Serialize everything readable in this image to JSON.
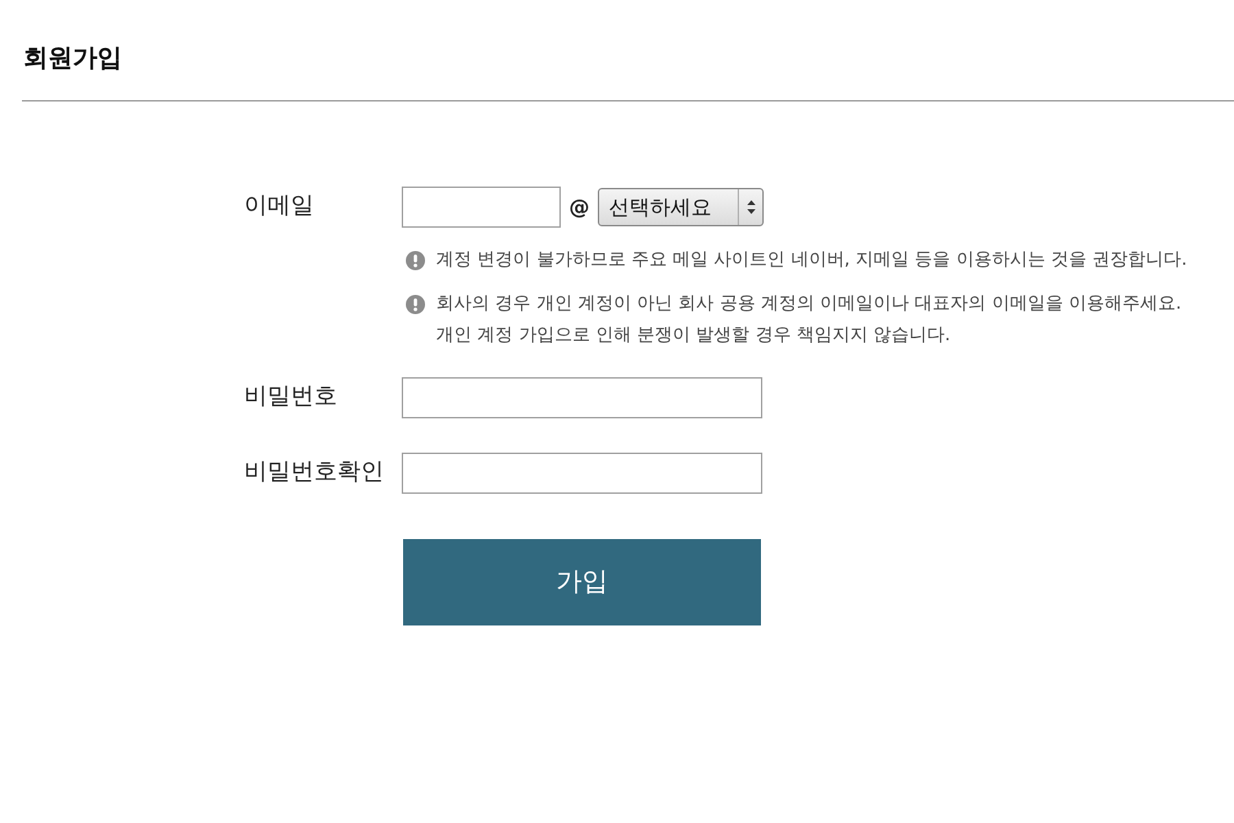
{
  "page": {
    "title": "회원가입"
  },
  "form": {
    "fields": [
      {
        "kind": "email",
        "label": "이메일",
        "at_sign": "@",
        "domain_select": {
          "value": "선택하세요"
        },
        "notes": [
          {
            "lines": [
              "계정 변경이 불가하므로 주요 메일 사이트인 네이버, 지메일 등을 이용하시는 것을 권장합니다."
            ]
          },
          {
            "lines": [
              "회사의 경우 개인 계정이 아닌 회사 공용 계정의 이메일이나 대표자의 이메일을 이용해주세요.",
              "개인 계정 가입으로 인해 분쟁이 발생할 경우 책임지지 않습니다."
            ]
          }
        ]
      },
      {
        "kind": "password",
        "label": "비밀번호"
      },
      {
        "kind": "password",
        "label": "비밀번호확인"
      }
    ],
    "submit": {
      "label": "가입"
    }
  }
}
